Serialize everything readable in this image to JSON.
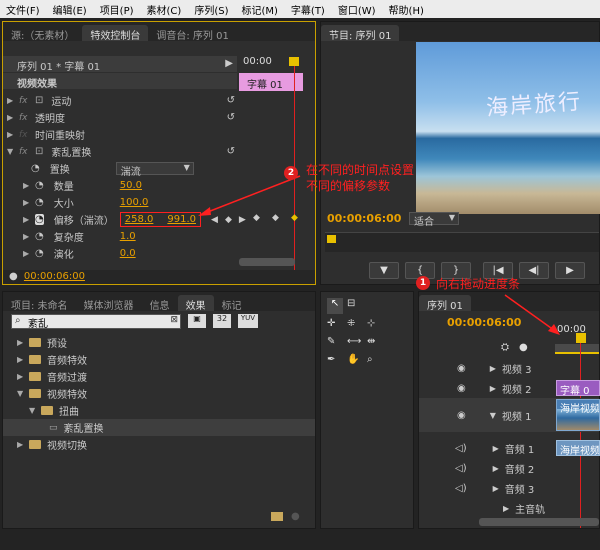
{
  "menu": [
    "文件(F)",
    "编辑(E)",
    "项目(P)",
    "素材(C)",
    "序列(S)",
    "标记(M)",
    "字幕(T)",
    "窗口(W)",
    "帮助(H)"
  ],
  "effect_controls": {
    "tabs": [
      "源:（无素材）",
      "特效控制台",
      "调音台: 序列 01"
    ],
    "sequence_label": "序列 01 * 字幕 01",
    "time": "00:00",
    "clip_label": "字幕 01",
    "section_title": "视频效果",
    "effects": [
      "运动",
      "透明度",
      "时间重映射",
      "紊乱置换"
    ],
    "params": [
      {
        "label": "置换",
        "value": "湍流"
      },
      {
        "label": "数量",
        "value": "50.0"
      },
      {
        "label": "大小",
        "value": "100.0"
      },
      {
        "label": "偏移（湍流）",
        "value": "258.0",
        "value2": "991.0"
      },
      {
        "label": "复杂度",
        "value": "1.0"
      },
      {
        "label": "演化",
        "value": "0.0"
      }
    ],
    "footer_time": "00:00:06:00"
  },
  "program": {
    "tab": "节目: 序列 01",
    "overlay_text": "海岸旅行",
    "timecode": "00:00:06:00",
    "fit": "适合"
  },
  "project": {
    "tabs": [
      "项目: 未命名",
      "媒体浏览器",
      "信息",
      "效果",
      "标记"
    ],
    "search_value": "紊乱",
    "tree": [
      {
        "label": "预设",
        "level": 0,
        "open": false
      },
      {
        "label": "音频特效",
        "level": 0,
        "open": false
      },
      {
        "label": "音频过渡",
        "level": 0,
        "open": false
      },
      {
        "label": "视频特效",
        "level": 0,
        "open": true
      },
      {
        "label": "扭曲",
        "level": 1,
        "open": true
      },
      {
        "label": "紊乱置换",
        "level": 2,
        "open": false
      },
      {
        "label": "视频切换",
        "level": 0,
        "open": false
      }
    ],
    "badges": [
      "32",
      "YUV"
    ]
  },
  "timeline": {
    "tab": "序列 01",
    "timecode": "00:00:06:00",
    "ruler": "00:00",
    "tracks": [
      {
        "label": "视频 3",
        "clip": ""
      },
      {
        "label": "视频 2",
        "clip": "字幕 0"
      },
      {
        "label": "视频 1",
        "clip": "海岸视频"
      },
      {
        "label": "音频 1",
        "clip": "海岸视频"
      },
      {
        "label": "音频 2",
        "clip": ""
      },
      {
        "label": "音频 3",
        "clip": ""
      },
      {
        "label": "主音轨",
        "clip": ""
      }
    ]
  },
  "annotations": {
    "a1_num": "1",
    "a1_text": "向右拖动进度条",
    "a2_num": "2",
    "a2_line1": "在不同的时间点设置",
    "a2_line2": "不同的偏移参数"
  },
  "colors": {
    "accent": "#e8a000",
    "annotation": "#ff2020",
    "clip_pink": "#e79be0",
    "clip_purple": "#9a5cc0",
    "clip_blue": "#4a7fb5"
  }
}
